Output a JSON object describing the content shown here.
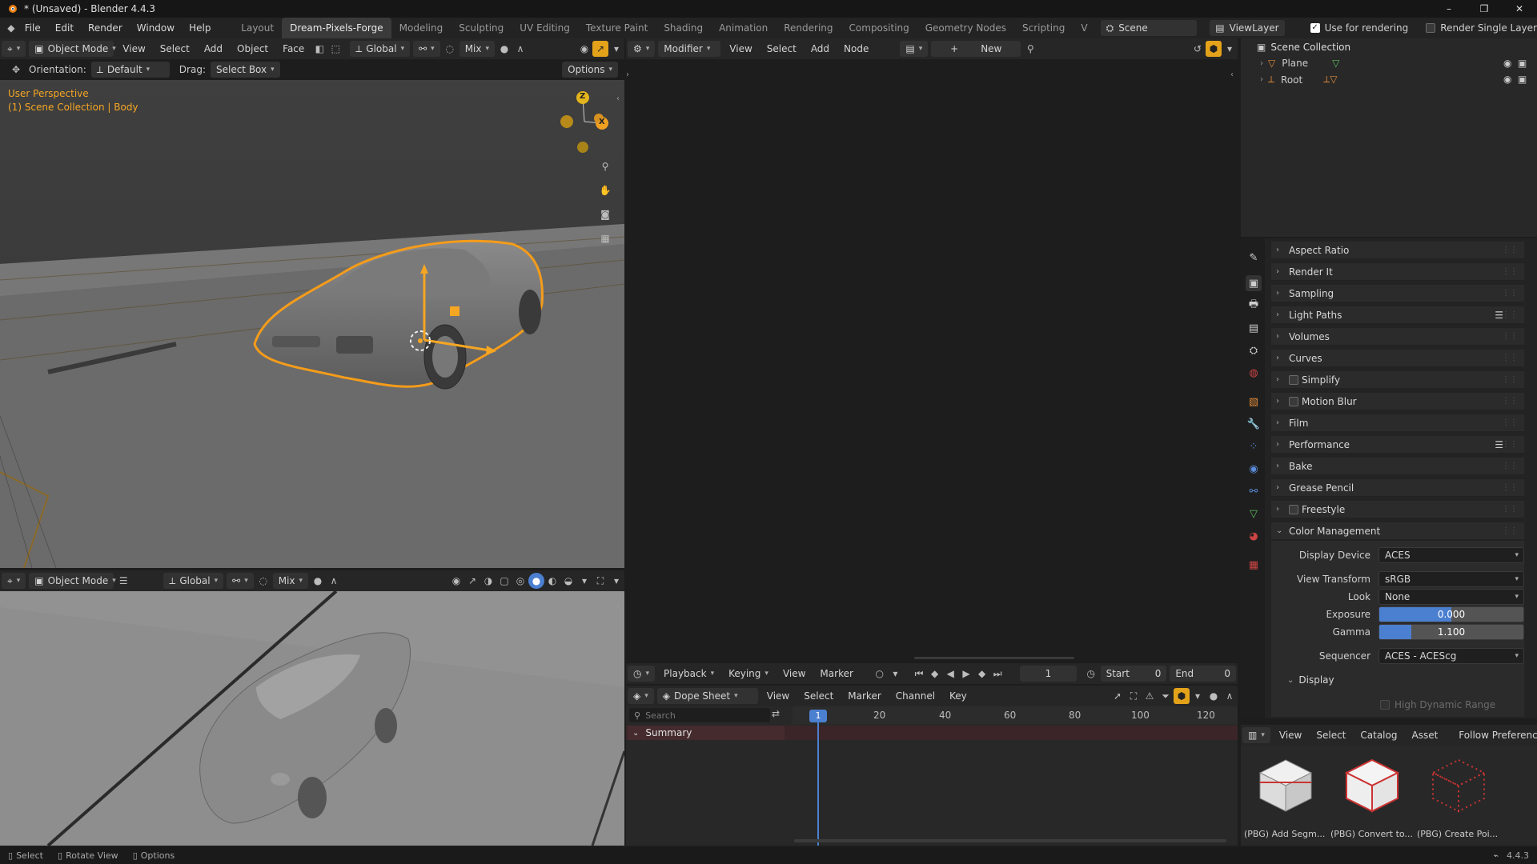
{
  "title": "* (Unsaved) - Blender 4.4.3",
  "window_controls": [
    "–",
    "❐",
    "✕"
  ],
  "menu": [
    "File",
    "Edit",
    "Render",
    "Window",
    "Help"
  ],
  "workspaces": [
    "Layout",
    "Dream-Pixels-Forge",
    "Modeling",
    "Sculpting",
    "UV Editing",
    "Texture Paint",
    "Shading",
    "Animation",
    "Rendering",
    "Compositing",
    "Geometry Nodes",
    "Scripting",
    "V"
  ],
  "scene": {
    "name": "Scene",
    "view_layer": "ViewLayer",
    "use_for_rendering": "Use for rendering",
    "render_single_layer": "Render Single Layer"
  },
  "vp1": {
    "mode": "Object Mode",
    "menus": [
      "View",
      "Select",
      "Add",
      "Object",
      "Face"
    ],
    "transform": "Global",
    "pivot": "Mix",
    "orientation_label": "Orientation:",
    "orientation": "Default",
    "drag_label": "Drag:",
    "drag": "Select Box",
    "options": "Options",
    "overlay_line1": "User Perspective",
    "overlay_line2": "(1) Scene Collection | Body",
    "gizmo": {
      "z": "Z",
      "x": "X"
    }
  },
  "vp2": {
    "mode": "Object Mode",
    "transform": "Global",
    "pivot": "Mix"
  },
  "node_editor": {
    "type": "Modifier",
    "menus": [
      "View",
      "Select",
      "Add",
      "Node"
    ],
    "new": "New"
  },
  "timeline": {
    "menus": [
      "Playback",
      "Keying",
      "View",
      "Marker"
    ],
    "frame": "1",
    "start_label": "Start",
    "start": "0",
    "end_label": "End",
    "end": "0"
  },
  "dopesheet": {
    "mode": "Dope Sheet",
    "menus": [
      "View",
      "Select",
      "Marker",
      "Channel",
      "Key"
    ],
    "search_placeholder": "Search",
    "summary": "Summary",
    "ruler": [
      "1",
      "20",
      "40",
      "60",
      "80",
      "100",
      "120"
    ]
  },
  "outliner": {
    "root": "Scene Collection",
    "items": [
      "Plane",
      "Root"
    ]
  },
  "properties": {
    "panels": [
      "Aspect Ratio",
      "Render It",
      "Sampling",
      "Light Paths",
      "Volumes",
      "Curves",
      "Simplify",
      "Motion Blur",
      "Film",
      "Performance",
      "Bake",
      "Grease Pencil",
      "Freestyle",
      "Color Management"
    ],
    "cm": {
      "display_device_label": "Display Device",
      "display_device": "ACES",
      "view_transform_label": "View Transform",
      "view_transform": "sRGB",
      "look_label": "Look",
      "look": "None",
      "exposure_label": "Exposure",
      "exposure": "0.000",
      "gamma_label": "Gamma",
      "gamma": "1.100",
      "sequencer_label": "Sequencer",
      "sequencer": "ACES - ACEScg",
      "display_sub": "Display",
      "hdr": "High Dynamic Range"
    }
  },
  "asset_browser": {
    "menus": [
      "View",
      "Select",
      "Catalog",
      "Asset"
    ],
    "follow": "Follow Preferences",
    "assets": [
      "(PBG) Add Segm...",
      "(PBG) Convert to...",
      "(PBG) Create Poi..."
    ]
  },
  "statusbar": {
    "items": [
      "Select",
      "Rotate View",
      "Options"
    ],
    "version": "4.4.3"
  },
  "colors": {
    "accent": "#f5a623",
    "selection": "#4b7fd0",
    "bg": "#1d1d1d"
  }
}
